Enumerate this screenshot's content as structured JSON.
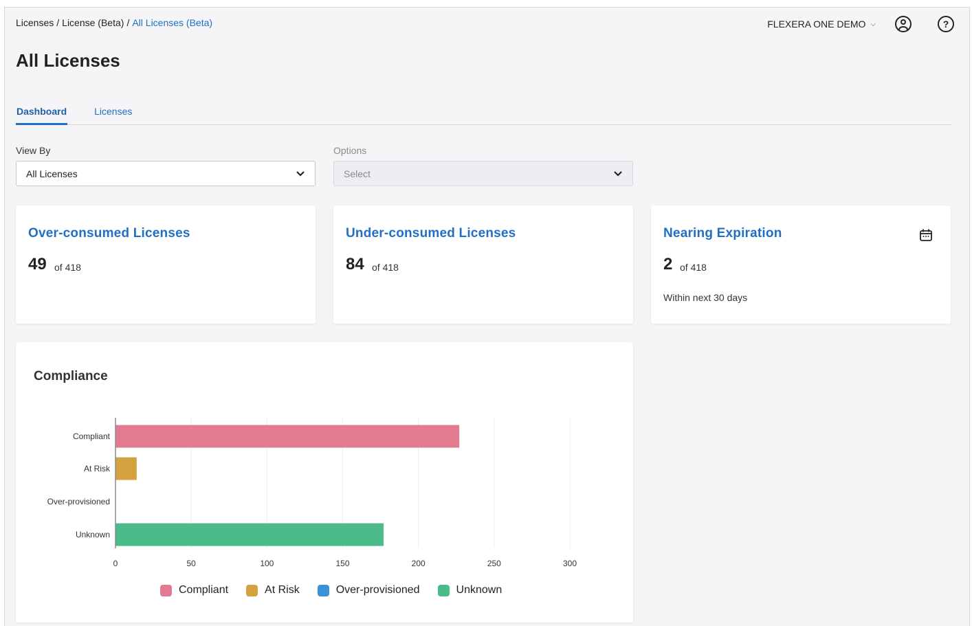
{
  "breadcrumb": {
    "items": [
      "Licenses",
      "License (Beta)"
    ],
    "current": "All Licenses (Beta)"
  },
  "header": {
    "org_name": "FLEXERA ONE DEMO",
    "user_icon": "user-circle-icon",
    "help_icon": "help-circle-icon"
  },
  "page": {
    "title": "All Licenses"
  },
  "tabs": [
    {
      "label": "Dashboard",
      "active": true
    },
    {
      "label": "Licenses",
      "active": false
    }
  ],
  "filters": {
    "view_by": {
      "label": "View By",
      "value": "All Licenses"
    },
    "options": {
      "label": "Options",
      "placeholder": "Select",
      "disabled": true
    }
  },
  "kpis": [
    {
      "title": "Over-consumed Licenses",
      "value": "49",
      "of": "of 418"
    },
    {
      "title": "Under-consumed Licenses",
      "value": "84",
      "of": "of 418"
    },
    {
      "title": "Nearing Expiration",
      "value": "2",
      "of": "of 418",
      "note": "Within next 30 days",
      "icon": "calendar-icon"
    }
  ],
  "compliance": {
    "title": "Compliance"
  },
  "colors": {
    "accent": "#1f6fc5",
    "compliant": "#e27b8f",
    "at_risk": "#d4a23f",
    "over_provisioned": "#3c92d6",
    "unknown": "#4bbb8a"
  },
  "chart_data": {
    "type": "bar",
    "orientation": "horizontal",
    "title": "Compliance",
    "categories": [
      "Compliant",
      "At Risk",
      "Over-provisioned",
      "Unknown"
    ],
    "values": [
      227,
      14,
      0,
      177
    ],
    "xlim": [
      0,
      300
    ],
    "xticks": [
      0,
      50,
      100,
      150,
      200,
      250,
      300
    ],
    "grid": "vertical",
    "legend": {
      "placement": "bottom",
      "entries": [
        "Compliant",
        "At Risk",
        "Over-provisioned",
        "Unknown"
      ]
    }
  }
}
